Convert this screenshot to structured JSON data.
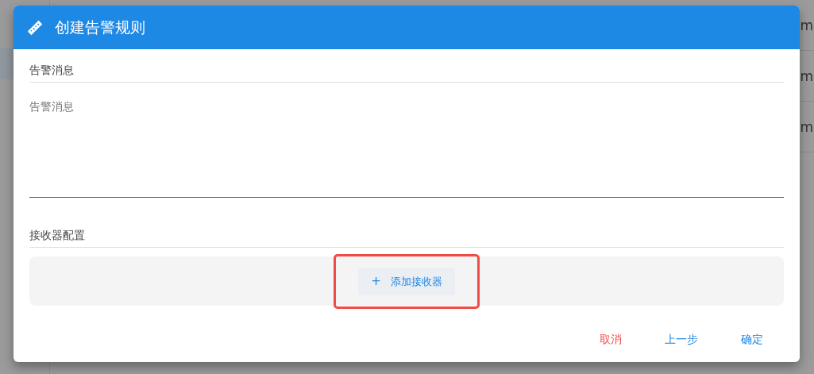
{
  "background": {
    "cells": [
      "m",
      "m",
      "m"
    ]
  },
  "dialog": {
    "title": "创建告警规则",
    "message_section": {
      "heading": "告警消息",
      "field": {
        "placeholder": "告警消息"
      }
    },
    "receiver_section": {
      "heading": "接收器配置",
      "add_button": {
        "label": "添加接收器",
        "icon": "+",
        "highlighted": true
      }
    },
    "actions": [
      {
        "label": "取消",
        "kind": "danger"
      },
      {
        "label": "上一步",
        "kind": "primary"
      },
      {
        "label": "确定",
        "kind": "primary"
      }
    ]
  }
}
